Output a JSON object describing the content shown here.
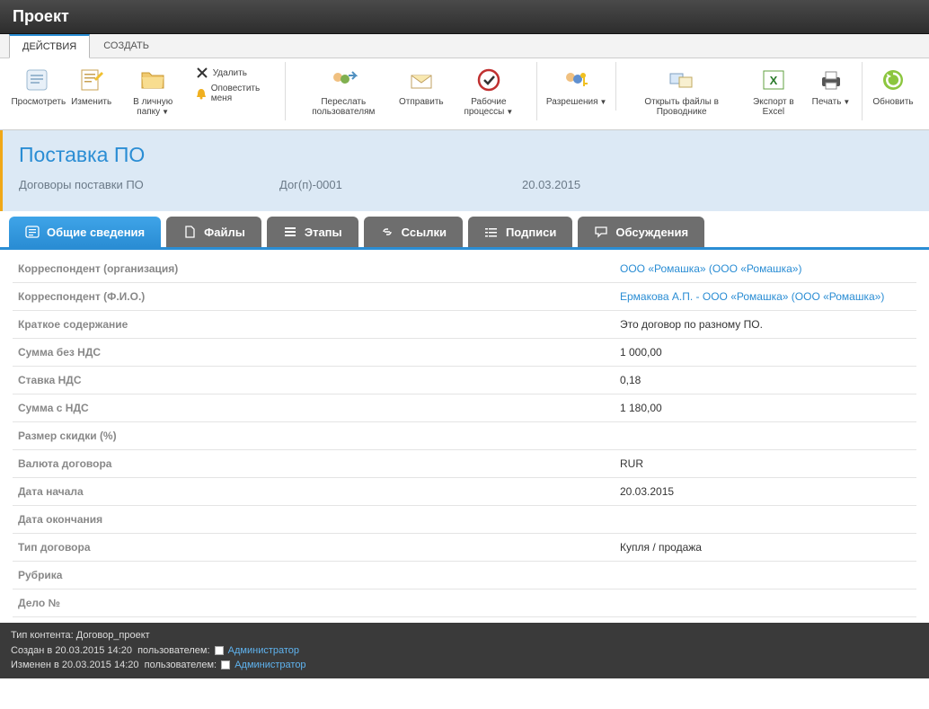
{
  "header": {
    "title": "Проект"
  },
  "ribbon_tabs": {
    "actions": "ДЕЙСТВИЯ",
    "create": "СОЗДАТЬ"
  },
  "ribbon": {
    "view": "Просмотреть",
    "edit": "Изменить",
    "personal_folder": "В личную папку",
    "delete": "Удалить",
    "notify": "Оповестить меня",
    "forward": "Переслать пользователям",
    "send": "Отправить",
    "workflows": "Рабочие процессы",
    "permissions": "Разрешения",
    "open_explorer": "Открыть файлы в Проводнике",
    "export_excel": "Экспорт в Excel",
    "print": "Печать",
    "refresh": "Обновить"
  },
  "info": {
    "title": "Поставка ПО",
    "category": "Договоры поставки ПО",
    "number": "Дог(п)-0001",
    "date": "20.03.2015"
  },
  "tabs": {
    "general": "Общие сведения",
    "files": "Файлы",
    "stages": "Этапы",
    "links": "Ссылки",
    "signatures": "Подписи",
    "discussions": "Обсуждения"
  },
  "fields": [
    {
      "label": "Корреспондент (организация)",
      "value": "ООО «Ромашка» (ООО «Ромашка»)",
      "link": true
    },
    {
      "label": "Корреспондент (Ф.И.О.)",
      "value": "Ермакова А.П. - ООО «Ромашка» (ООО «Ромашка»)",
      "link": true
    },
    {
      "label": "Краткое содержание",
      "value": "Это договор по разному ПО."
    },
    {
      "label": "Сумма без НДС",
      "value": "1 000,00"
    },
    {
      "label": "Ставка НДС",
      "value": "0,18"
    },
    {
      "label": "Сумма с НДС",
      "value": "1 180,00"
    },
    {
      "label": "Размер скидки (%)",
      "value": ""
    },
    {
      "label": "Валюта договора",
      "value": "RUR"
    },
    {
      "label": "Дата начала",
      "value": "20.03.2015"
    },
    {
      "label": "Дата окончания",
      "value": ""
    },
    {
      "label": "Тип договора",
      "value": "Купля / продажа"
    },
    {
      "label": "Рубрика",
      "value": ""
    },
    {
      "label": "Дело №",
      "value": ""
    }
  ],
  "footer": {
    "content_type_label": "Тип контента:",
    "content_type": "Договор_проект",
    "created_label": "Создан в",
    "created_date": "20.03.2015 14:20",
    "by_label": "пользователем:",
    "modified_label": "Изменен в",
    "modified_date": "20.03.2015 14:20",
    "admin": "Администратор"
  }
}
